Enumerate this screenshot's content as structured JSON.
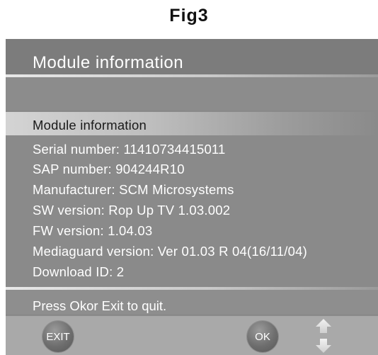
{
  "caption": "Fig3",
  "screen": {
    "title": "Module information",
    "selected_item": "Module information",
    "info_lines": [
      "Serial number: 11410734415011",
      "SAP number: 904244R10",
      "Manufacturer: SCM Microsystems",
      "SW version: Rop Up TV 1.03.002",
      "FW version: 1.04.03",
      "Mediaguard version: Ver 01.03 R 04(16/11/04)",
      "Download ID: 2"
    ],
    "status": "Press Okor Exit to quit."
  },
  "buttons": {
    "exit_label": "EXIT",
    "ok_label": "OK",
    "nav_icon": "up-down-arrows-icon"
  },
  "colors": {
    "panel": "#8a8a8a",
    "highlight": "#d4d4d4",
    "button_bar": "#a9a9a9",
    "text": "#ffffff"
  }
}
